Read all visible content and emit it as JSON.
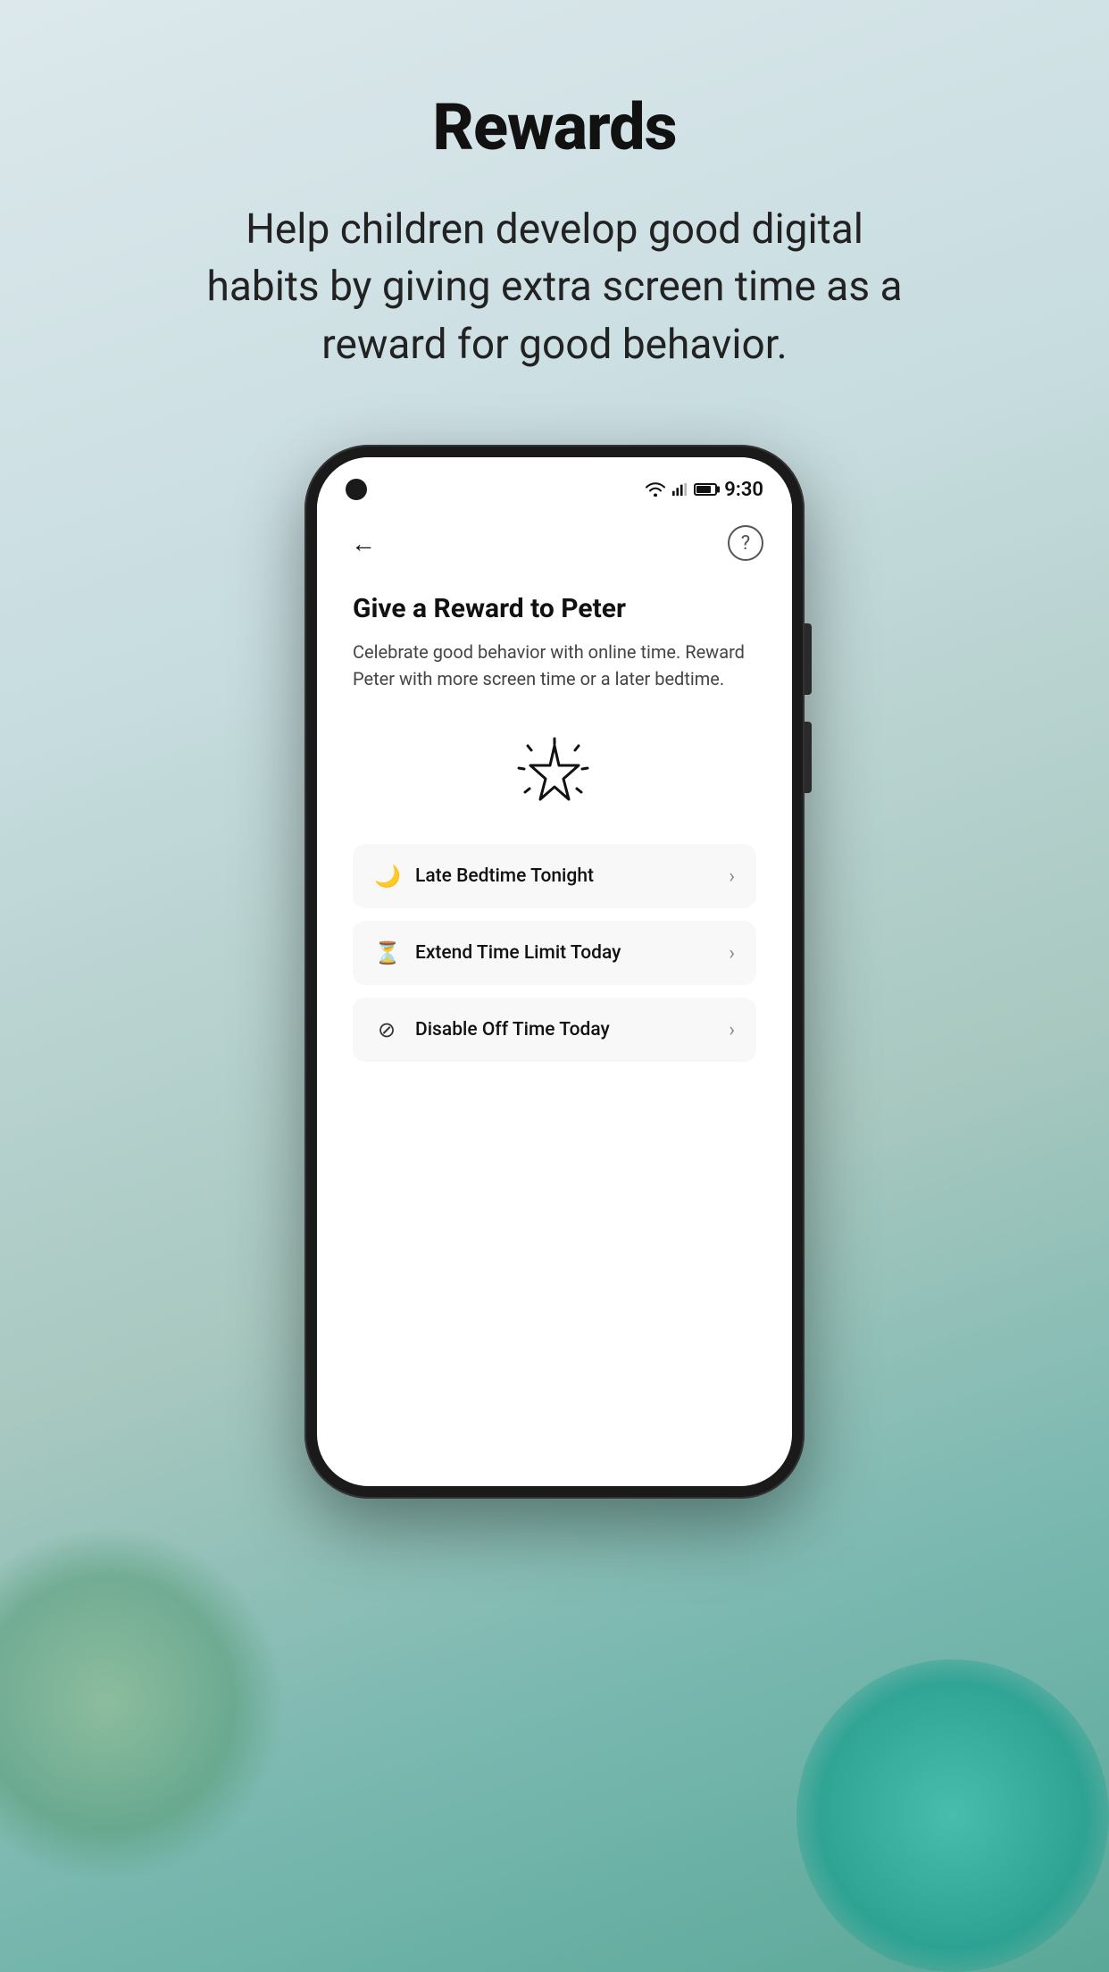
{
  "page": {
    "title": "Rewards",
    "subtitle": "Help children develop good digital habits by giving extra screen time as a reward for good behavior."
  },
  "statusBar": {
    "time": "9:30"
  },
  "phone": {
    "screenTitle": "Give a Reward to Peter",
    "screenDesc": "Celebrate good behavior with online time. Reward Peter with more screen time or a later bedtime.",
    "menuItems": [
      {
        "id": "late-bedtime",
        "icon": "🌙",
        "label": "Late Bedtime Tonight"
      },
      {
        "id": "extend-time",
        "icon": "⏳",
        "label": "Extend Time Limit Today"
      },
      {
        "id": "disable-offtime",
        "icon": "⊘",
        "label": "Disable Off Time Today"
      }
    ]
  },
  "icons": {
    "back": "←",
    "help": "?",
    "chevron": "›"
  }
}
